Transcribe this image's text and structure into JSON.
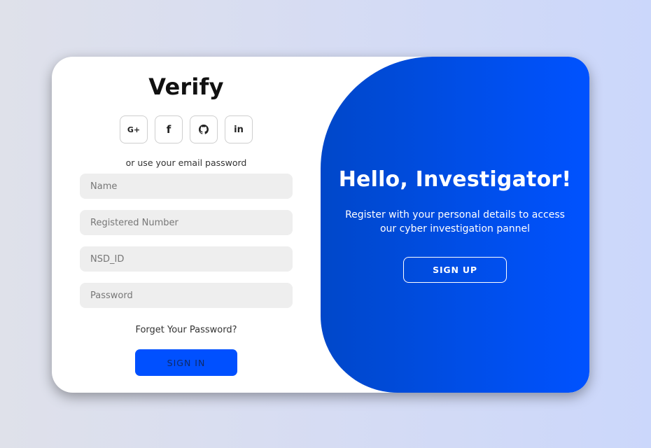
{
  "signin_panel": {
    "title": "Verify",
    "socials": [
      {
        "icon": "google-plus-icon",
        "glyph": "G+"
      },
      {
        "icon": "facebook-icon",
        "glyph": "f"
      },
      {
        "icon": "github-icon",
        "glyph": ""
      },
      {
        "icon": "linkedin-icon",
        "glyph": "in"
      }
    ],
    "alt_text": "or use your email password",
    "fields": {
      "name_placeholder": "Name",
      "registered_number_placeholder": "Registered Number",
      "nsd_id_placeholder": "NSD_ID",
      "password_placeholder": "Password"
    },
    "forgot_label": "Forget Your Password?",
    "signin_label": "SIGN IN"
  },
  "welcome_panel": {
    "title": "Hello, Investigator!",
    "subtitle": "Register with your personal details to access our cyber investigation pannel",
    "signup_label": "SIGN UP"
  },
  "colors": {
    "accent": "#0050ff",
    "panel_gradient_start": "#0047c9",
    "panel_gradient_end": "#0052ff",
    "input_bg": "#eeeeee"
  }
}
